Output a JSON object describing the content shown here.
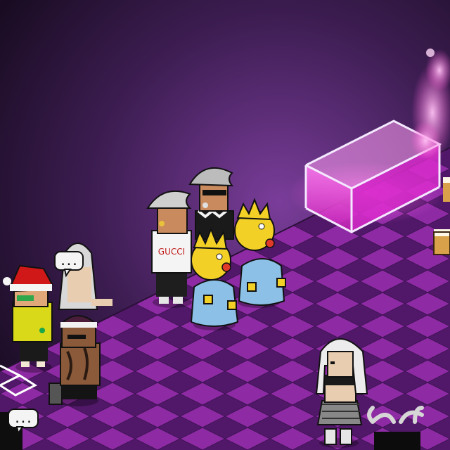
{
  "scene": {
    "room_name": "",
    "colors": {
      "wall_top": "#1f1129",
      "wall_glow": "#7a3d9a",
      "floor_dark": "#5b1f77",
      "floor_light": "#b23bc2",
      "floor_mid": "#8a2ca5",
      "fog_pink": "#ff6fd8",
      "glass_pink": "#ff44e3"
    }
  },
  "speech_bubbles": [
    {
      "id": "bubble-1",
      "text": "..."
    },
    {
      "id": "bubble-2",
      "text": "..."
    }
  ],
  "avatars": [
    {
      "id": "santa-hat-avatar",
      "label": ""
    },
    {
      "id": "white-hair-girl-avatar",
      "label": ""
    },
    {
      "id": "beanie-tattoo-avatar",
      "label": ""
    },
    {
      "id": "grey-mohawk-avatar",
      "label": ""
    },
    {
      "id": "sunglasses-mohawk-avatar",
      "label": ""
    },
    {
      "id": "maggie-left-avatar",
      "label": ""
    },
    {
      "id": "maggie-right-avatar",
      "label": ""
    },
    {
      "id": "platinum-hair-girl-avatar",
      "label": ""
    }
  ],
  "shirt_text": "GUCCI"
}
